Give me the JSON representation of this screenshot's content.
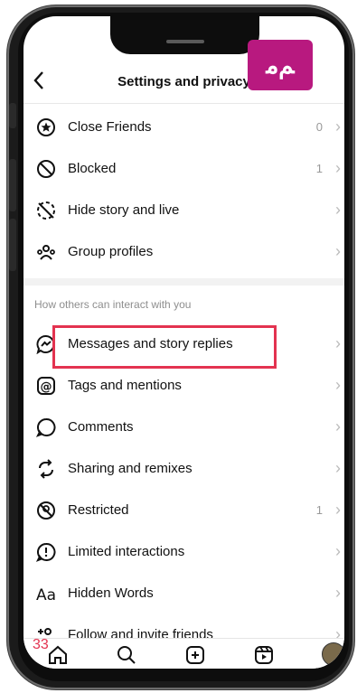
{
  "header": {
    "title": "Settings and privacy",
    "back_icon": "chevron-left-icon"
  },
  "logo": {
    "text": "ﻢﻣ",
    "color": "#b8197f"
  },
  "rows_top": [
    {
      "label": "Close Friends",
      "icon": "star-circle-icon",
      "count": "0"
    },
    {
      "label": "Blocked",
      "icon": "blocked-icon",
      "count": "1"
    },
    {
      "label": "Hide story and live",
      "icon": "hide-story-icon",
      "count": ""
    },
    {
      "label": "Group profiles",
      "icon": "group-icon",
      "count": ""
    }
  ],
  "section": {
    "title": "How others can interact with you"
  },
  "rows_bottom": [
    {
      "label": "Messages and story replies",
      "icon": "messenger-icon",
      "count": ""
    },
    {
      "label": "Tags and mentions",
      "icon": "at-icon",
      "count": ""
    },
    {
      "label": "Comments",
      "icon": "comment-icon",
      "count": ""
    },
    {
      "label": "Sharing and remixes",
      "icon": "share-remix-icon",
      "count": ""
    },
    {
      "label": "Restricted",
      "icon": "restricted-icon",
      "count": "1"
    },
    {
      "label": "Limited interactions",
      "icon": "limited-icon",
      "count": ""
    },
    {
      "label": "Hidden Words",
      "icon": "aa-icon",
      "count": ""
    },
    {
      "label": "Follow and invite friends",
      "icon": "add-person-icon",
      "count": ""
    }
  ],
  "tabbar": {
    "overlay_number": "33"
  },
  "colors": {
    "highlight": "#e33350",
    "accent": "#b8197f"
  }
}
